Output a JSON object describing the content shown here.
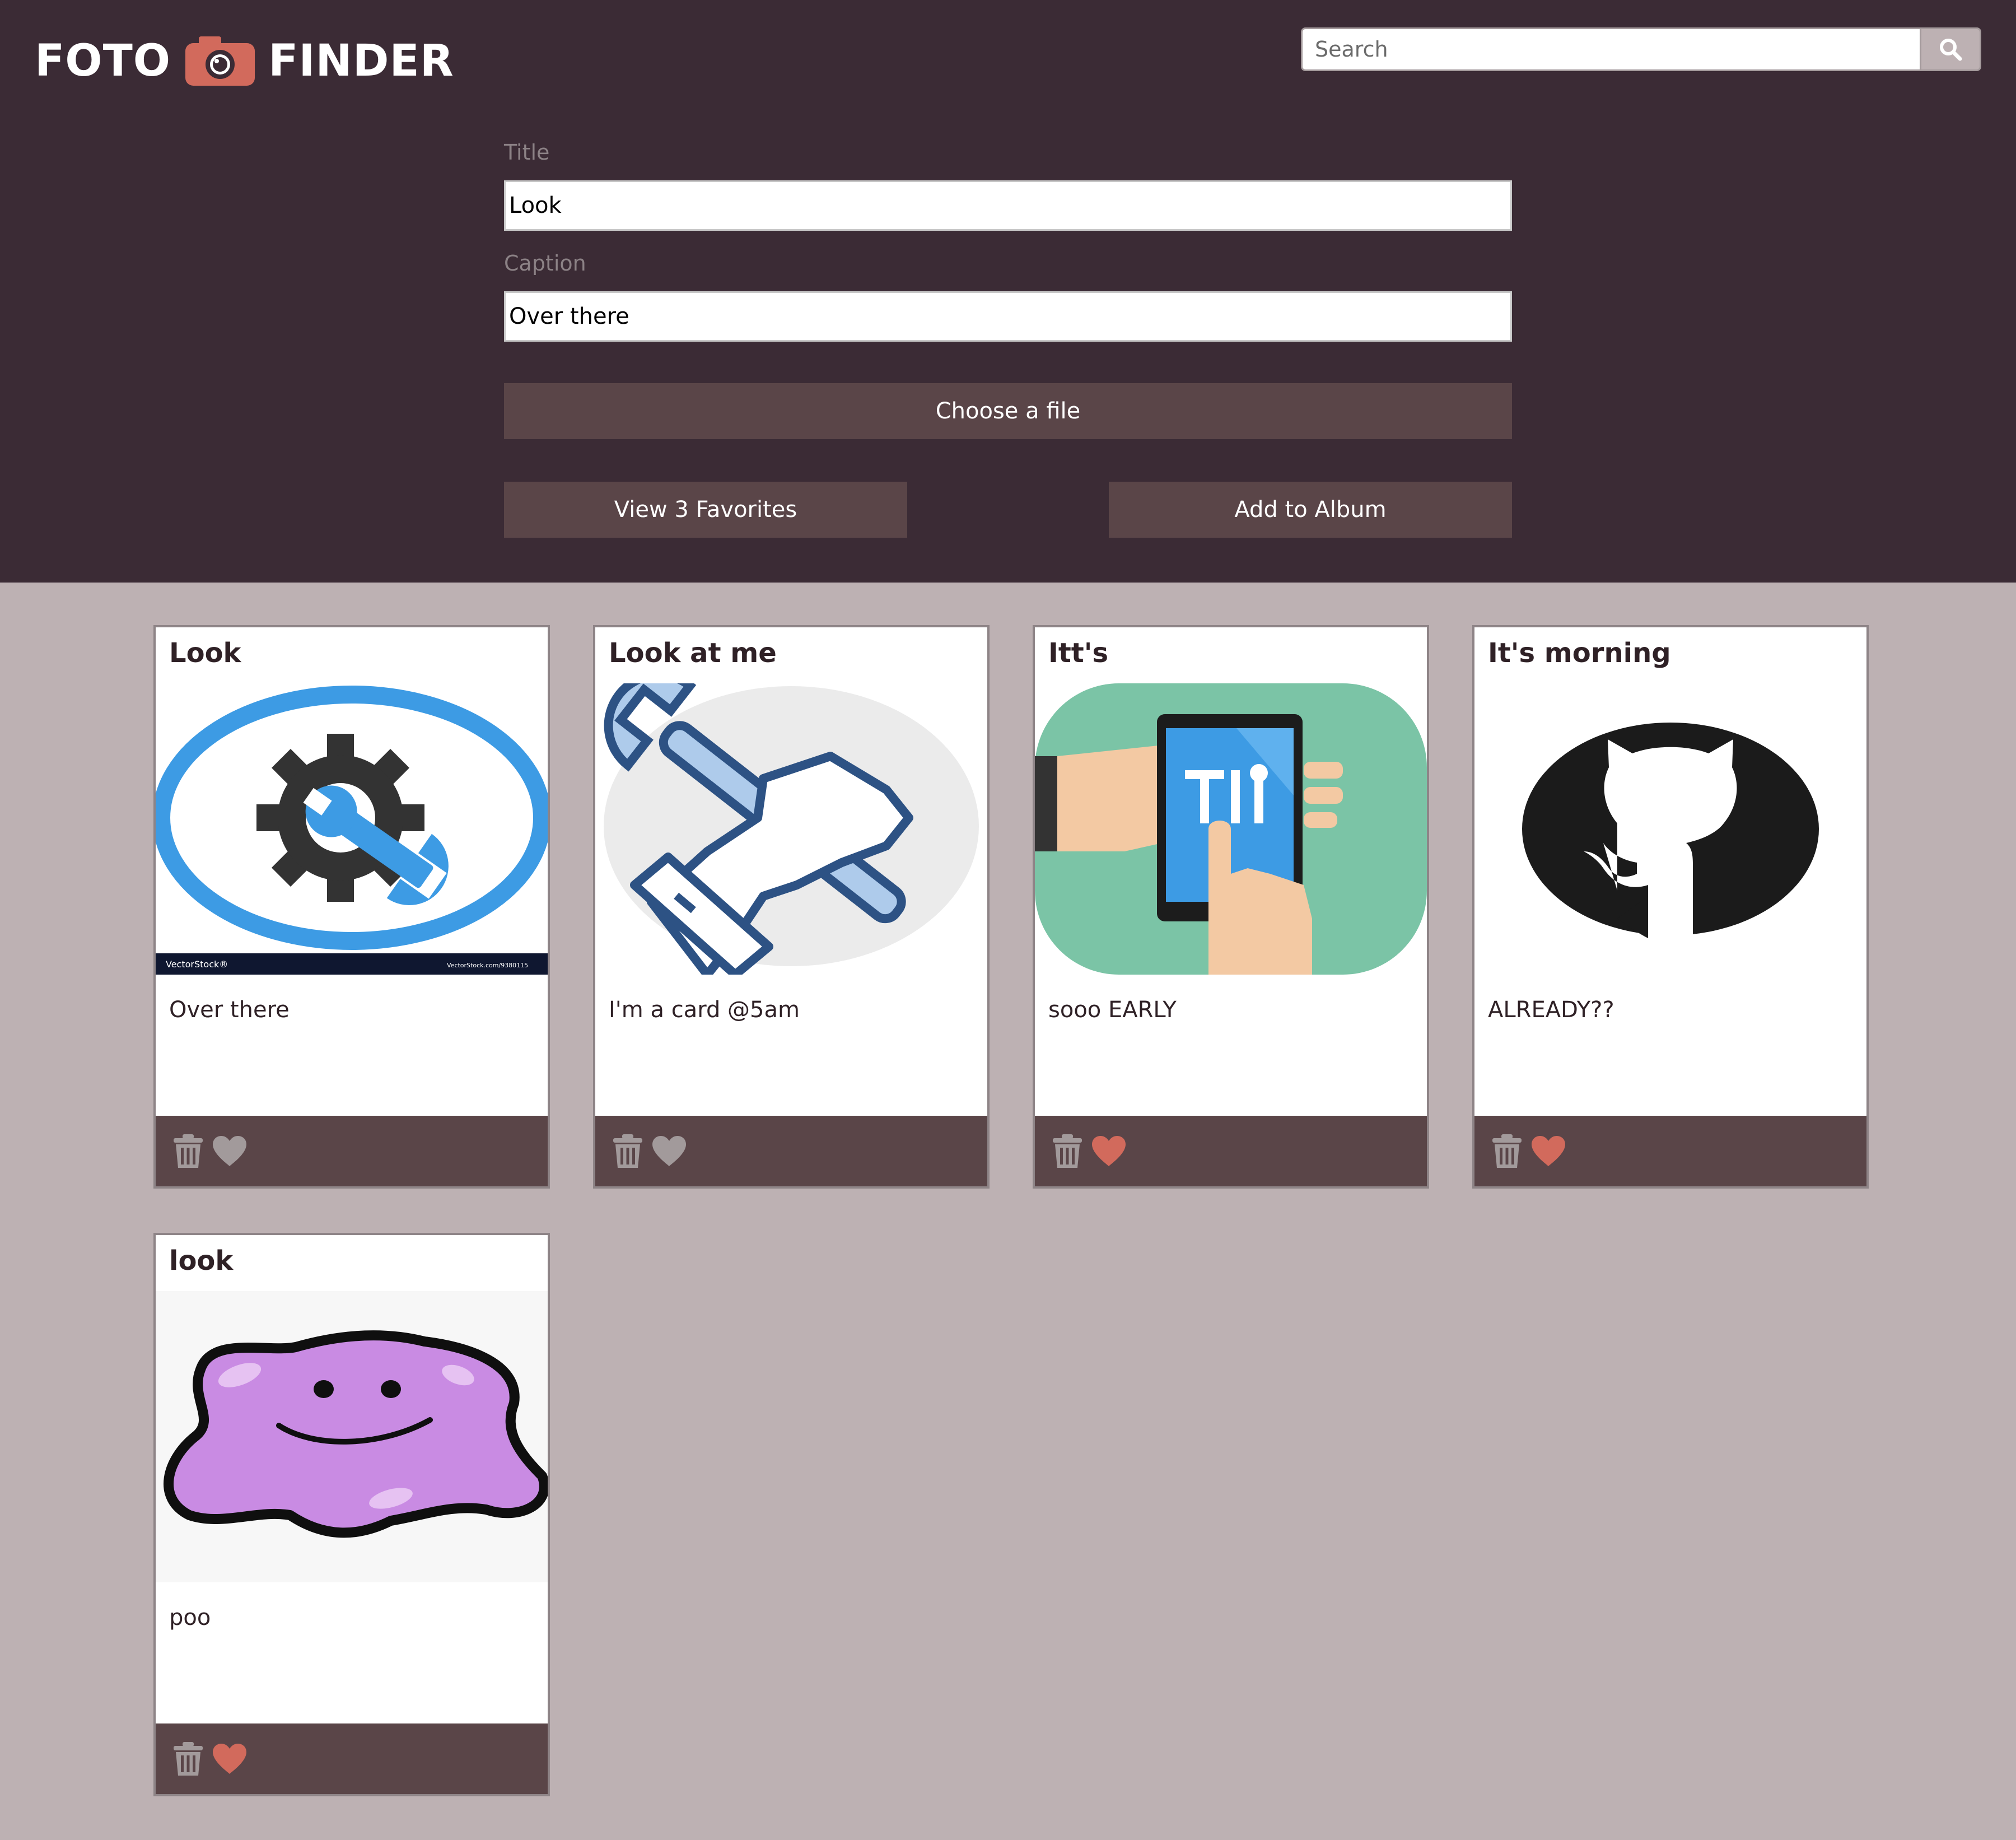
{
  "app": {
    "logo_left": "FOTO",
    "logo_right": "FINDER",
    "camera_icon": "camera-icon"
  },
  "search": {
    "placeholder": "Search",
    "value": "",
    "icon": "search-icon"
  },
  "form": {
    "title_label": "Title",
    "title_value": "Look",
    "caption_label": "Caption",
    "caption_value": "Over there",
    "choose_file_label": "Choose a file",
    "view_favorites_label": "View 3 Favorites",
    "add_album_label": "Add to Album"
  },
  "colors": {
    "header_bg": "#3b2b35",
    "page_bg": "#bdb1b3",
    "button_bg": "#5a4548",
    "favorite_active": "#d26a5c",
    "favorite_inactive": "#a29a9b"
  },
  "cards": [
    {
      "title": "Look",
      "caption": "Over there",
      "image": "gear-wrench-circle-image",
      "favorited": false
    },
    {
      "title": "Look at me",
      "caption": "I'm a card @5am",
      "image": "hand-wrench-image",
      "favorited": false
    },
    {
      "title": "Itt's",
      "caption": "sooo EARLY",
      "image": "phone-tools-image",
      "favorited": true
    },
    {
      "title": "It's morning",
      "caption": "ALREADY??",
      "image": "github-octocat-image",
      "favorited": true
    },
    {
      "title": "look",
      "caption": "poo",
      "image": "ditto-blob-image",
      "favorited": true
    }
  ]
}
